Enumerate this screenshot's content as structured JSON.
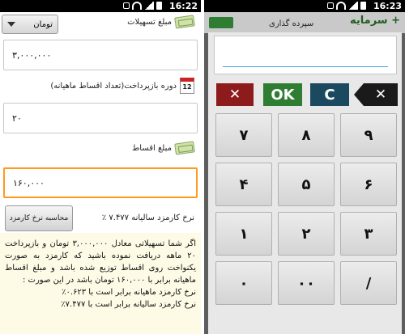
{
  "status_bar": {
    "left_time": "16:22",
    "right_time": "16:23"
  },
  "left": {
    "dropdown_value": "تومان",
    "loan_amount_label": "مبلغ تسهیلات",
    "loan_amount_value": "۳,۰۰۰,۰۰۰",
    "period_label": "دوره بازپرداخت(تعداد اقساط ماهیانه)",
    "calendar_icon_text": "12",
    "period_value": "۲۰",
    "installment_label": "مبلغ اقساط",
    "installment_value": "۱۶۰,۰۰۰",
    "calc_button_label": "محاسبه نرخ کارمزد",
    "annual_rate_text": "نرخ کارمزد سالیانه ۷.۴۷۷ ٪",
    "result_para": "اگر شما تسهیلاتی معادل ۳,۰۰۰,۰۰۰ تومان و بازپرداخت ۲۰ ماهه دریافت نموده باشید که کارمزد به صورت یکنواخت روی اقساط توزیع شده باشد و مبلغ اقساط ماهیانه برابر با ۱۶۰,۰۰۰ تومان باشد در این صورت :",
    "result_monthly": "نرخ کارمزد ماهیانه برابر است با ۰.۶۲۳٪",
    "result_annual": "نرخ کارمزد سالیانه برابر است با ۷.۴۷۷٪"
  },
  "right": {
    "behind_title": "سرمایه +",
    "behind_subtitle": "سپرده گذاری",
    "display_value": "",
    "cancel_label": "✕",
    "ok_label": "OK",
    "clear_label": "C",
    "backspace_label": "✕",
    "keys": [
      "۹",
      "۸",
      "۷",
      "۶",
      "۵",
      "۴",
      "۳",
      "۲",
      "۱",
      "/",
      "۰۰",
      "۰"
    ]
  },
  "colors": {
    "cancel": "#8e1b1b",
    "ok": "#2e7d32",
    "clear": "#1b4a60",
    "active_field_border": "#ff9a1f",
    "result_bg": "#fdfbe6"
  }
}
